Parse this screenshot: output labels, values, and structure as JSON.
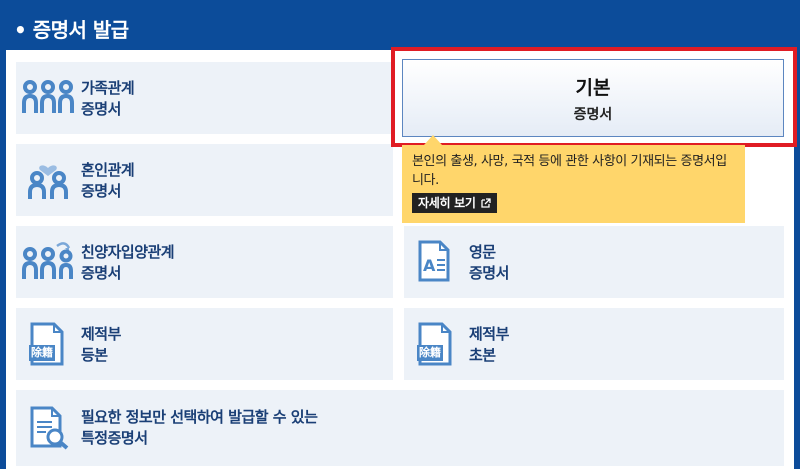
{
  "header": {
    "title": "• 증명서 발급"
  },
  "cards": {
    "family": {
      "line1": "가족관계",
      "line2": "증명서"
    },
    "marriage": {
      "line1": "혼인관계",
      "line2": "증명서"
    },
    "adoption": {
      "line1": "친양자입양관계",
      "line2": "증명서"
    },
    "english": {
      "line1": "영문",
      "line2": "증명서"
    },
    "removed_full": {
      "line1": "제적부",
      "line2": "등본",
      "stamp": "除籍"
    },
    "removed_abstract": {
      "line1": "제적부",
      "line2": "초본",
      "stamp": "除籍"
    },
    "specific": {
      "line1": "필요한 정보만 선택하여 발급할 수 있는",
      "line2": "특정증명서"
    }
  },
  "basic": {
    "line1": "기본",
    "line2": "증명서"
  },
  "tooltip": {
    "description": "본인의 출생, 사망, 국적 등에 관한 사항이 기재되는 증명서입니다.",
    "more_label": "자세히 보기",
    "more_icon": "external-link-icon"
  },
  "colors": {
    "header_bg": "#0c4c9a",
    "card_bg": "#edf2f8",
    "highlight": "#e01c24",
    "tooltip_bg": "#ffd66b",
    "icon": "#4a86c6"
  }
}
